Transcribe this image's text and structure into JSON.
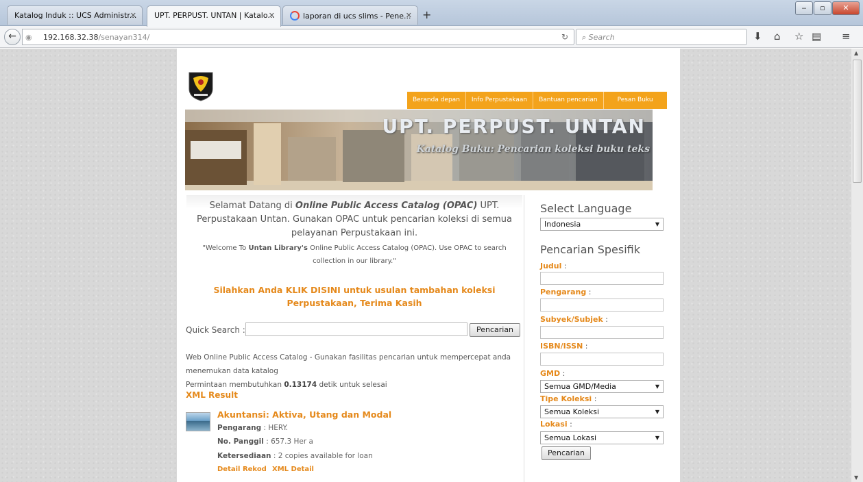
{
  "browser": {
    "tabs": [
      {
        "label": "Katalog Induk :: UCS Administr..."
      },
      {
        "label": "UPT. PERPUST. UNTAN | Katalo..."
      },
      {
        "label": "laporan di ucs slims - Pene..."
      }
    ],
    "new_tab": "+",
    "url_host": "192.168.32.38",
    "url_path": "/senayan314/",
    "search_placeholder": "Search"
  },
  "site": {
    "nav": [
      "Beranda depan",
      "Info Perpustakaan",
      "Bantuan pencarian",
      "Pesan Buku"
    ],
    "banner_title": "UPT. PERPUST. UNTAN",
    "banner_subtitle": "Katalog Buku: Pencarian koleksi buku teks",
    "welcome_prefix": "Selamat Datang di ",
    "welcome_bold": "Online Public Access Catalog (OPAC)",
    "welcome_suffix": " UPT. Perpustakaan Untan. Gunakan OPAC untuk pencarian koleksi di semua pelayanan Perpustakaan ini.",
    "welcome_en_prefix": "\"Welcome To ",
    "welcome_en_bold": "Untan Library's",
    "welcome_en_suffix": " Online Public Access Catalog (OPAC). Use OPAC to search collection in our library.\"",
    "usulan": "Silahkan Anda KLIK DISINI untuk usulan tambahan koleksi Perpustakaan, Terima Kasih",
    "quick_search_label": "Quick Search :",
    "quick_search_value": "",
    "quick_search_button": "Pencarian",
    "info_line1": "Web Online Public Access Catalog - Gunakan fasilitas pencarian untuk mempercepat anda menemukan data katalog",
    "info_time_prefix": "Permintaan membutuhkan ",
    "info_time_value": "0.13174",
    "info_time_suffix": " detik untuk selesai",
    "xml_result": "XML Result",
    "result": {
      "title": "Akuntansi: Aktiva, Utang dan Modal",
      "author_label": "Pengarang",
      "author": " : HERY.",
      "call_label": "No. Panggil",
      "call": " : 657.3 Her a",
      "avail_label": "Ketersediaan",
      "avail": " : 2 copies available for loan",
      "link_detail": "Detail Rekod",
      "link_xml": "XML Detail"
    }
  },
  "sidebar": {
    "lang_heading": "Select Language",
    "lang_value": "Indonesia",
    "spec_heading": "Pencarian Spesifik",
    "judul_label": "Judul",
    "pengarang_label": "Pengarang",
    "subyek_label": "Subyek/Subjek",
    "isbn_label": "ISBN/ISSN",
    "gmd_label": "GMD",
    "gmd_value": "Semua GMD/Media",
    "tipe_label": "Tipe Koleksi",
    "tipe_value": "Semua Koleksi",
    "lokasi_label": "Lokasi",
    "lokasi_value": "Semua Lokasi",
    "button": "Pencarian",
    "colon": " :"
  },
  "colors": {
    "accent": "#f3a31b",
    "link": "#e5891b"
  }
}
